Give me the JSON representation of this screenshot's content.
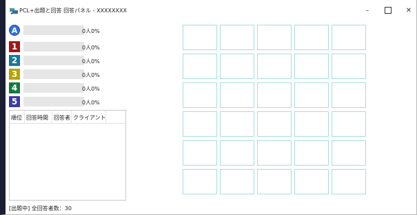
{
  "window": {
    "title": "PCL+出題と回答 回答パネル - XXXXXXXX",
    "controls": {
      "minimize": "–",
      "close": "✕"
    }
  },
  "answers": [
    {
      "label": "A",
      "shape": "circle",
      "color": "#2f6fe4",
      "count": "0人",
      "percent": "0%",
      "progress": 0
    },
    {
      "label": "1",
      "shape": "square",
      "color": "#a31515",
      "count": "0人",
      "percent": "0%",
      "progress": 0
    },
    {
      "label": "2",
      "shape": "square",
      "color": "#137a9c",
      "count": "0人",
      "percent": "0%",
      "progress": 0
    },
    {
      "label": "3",
      "shape": "square",
      "color": "#b5a300",
      "count": "0人",
      "percent": "0%",
      "progress": 0
    },
    {
      "label": "4",
      "shape": "square",
      "color": "#147a3c",
      "count": "0人",
      "percent": "0%",
      "progress": 0
    },
    {
      "label": "5",
      "shape": "square",
      "color": "#3b3ca3",
      "count": "0人",
      "percent": "0%",
      "progress": 0
    }
  ],
  "list": {
    "columns": [
      "順位",
      "回答時間",
      "回答者",
      "クライアント"
    ],
    "rows": []
  },
  "status": "[出題中] 全回答者数：30",
  "panel_grid": {
    "columns": 5,
    "rows": 6
  },
  "colors": {
    "window_border": "#1b1f33",
    "cell_border": "#a8dcdc",
    "bar_bg": "#e6e6e6"
  }
}
